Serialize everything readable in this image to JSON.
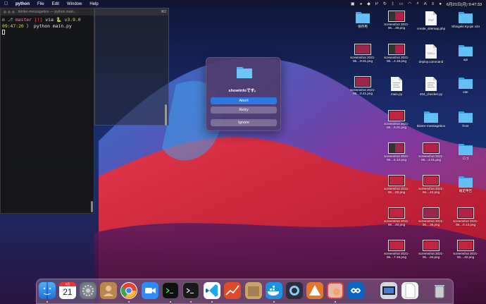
{
  "menubar": {
    "app_name": "python",
    "menus": [
      "File",
      "Edit",
      "Window",
      "Help"
    ],
    "datetime": "6月21日(月) 9:47:33"
  },
  "terminal": {
    "title": "tkinter-messagebox — python main...",
    "line1": {
      "prefix": "n",
      "branch_label": "master",
      "flags": "[!]",
      "via": "via",
      "python_version": "v3.9.0"
    },
    "line2": {
      "time": "09:47:20",
      "arrow": "〉",
      "command": "python main.py"
    }
  },
  "dialog": {
    "message": "showinfoです。",
    "buttons": [
      "Abort",
      "Retry",
      "Ignore"
    ]
  },
  "desktop_icons": [
    {
      "label": "保存用"
    },
    {
      "label": "screenshot 2021-06....49.png"
    },
    {
      "label": "create_sitemap.php"
    },
    {
      "label": "Shingeki Kyojin v34"
    },
    {
      "label": "screenshot 2021-06....9.01.png"
    },
    {
      "label": "screenshot 2021-06....4.18.png"
    },
    {
      "label": "deploy.command"
    },
    {
      "label": "api"
    },
    {
      "label": "screenshot 2021-06....0.41.png"
    },
    {
      "label": "main.py"
    },
    {
      "label": "404_checker.py"
    },
    {
      "label": "site"
    },
    {
      "label": "screenshot 2021-06....6.01.png"
    },
    {
      "label": "tkinter-messagebox"
    },
    {
      "label": "front"
    },
    {
      "label": "screenshot 2021-06....5.12.png"
    },
    {
      "label": "screenshot 2021-06....4.01.png"
    },
    {
      "label": "ロゴ"
    },
    {
      "label": "screenshot 2021-06....00.png"
    },
    {
      "label": "screenshot 2021-06....42.png"
    },
    {
      "label": "確定申告"
    },
    {
      "label": "screenshot 2021-06....40.png"
    },
    {
      "label": "screenshot 2021-06....35.png"
    },
    {
      "label": "screenshot 2021-06....0.13.png"
    },
    {
      "label": "screenshot 2021-06....7.18.png"
    },
    {
      "label": "screenshot 2021-06....34.png"
    },
    {
      "label": "screenshot 2021-06....42.png"
    }
  ],
  "dock": {
    "calendar_month": "6月",
    "calendar_day": "21",
    "apps": [
      "finder-icon",
      "calendar-icon",
      "system-preferences-icon",
      "contacts-icon",
      "chrome-icon",
      "zoom-icon",
      "terminal-icon",
      "terminal-2-icon",
      "vscode-icon",
      "activity-icon",
      "archive-utility-icon",
      "docker-icon",
      "quicktime-icon",
      "sourcetree-icon",
      "preview-icon",
      "infinity-icon",
      "screenshot-stack-icon",
      "document-stack-icon",
      "trash-icon"
    ]
  },
  "colors": {
    "accent": "#2f77e0",
    "folder": "#4fb4f0",
    "dialog_bg": "#4e3c6e"
  }
}
